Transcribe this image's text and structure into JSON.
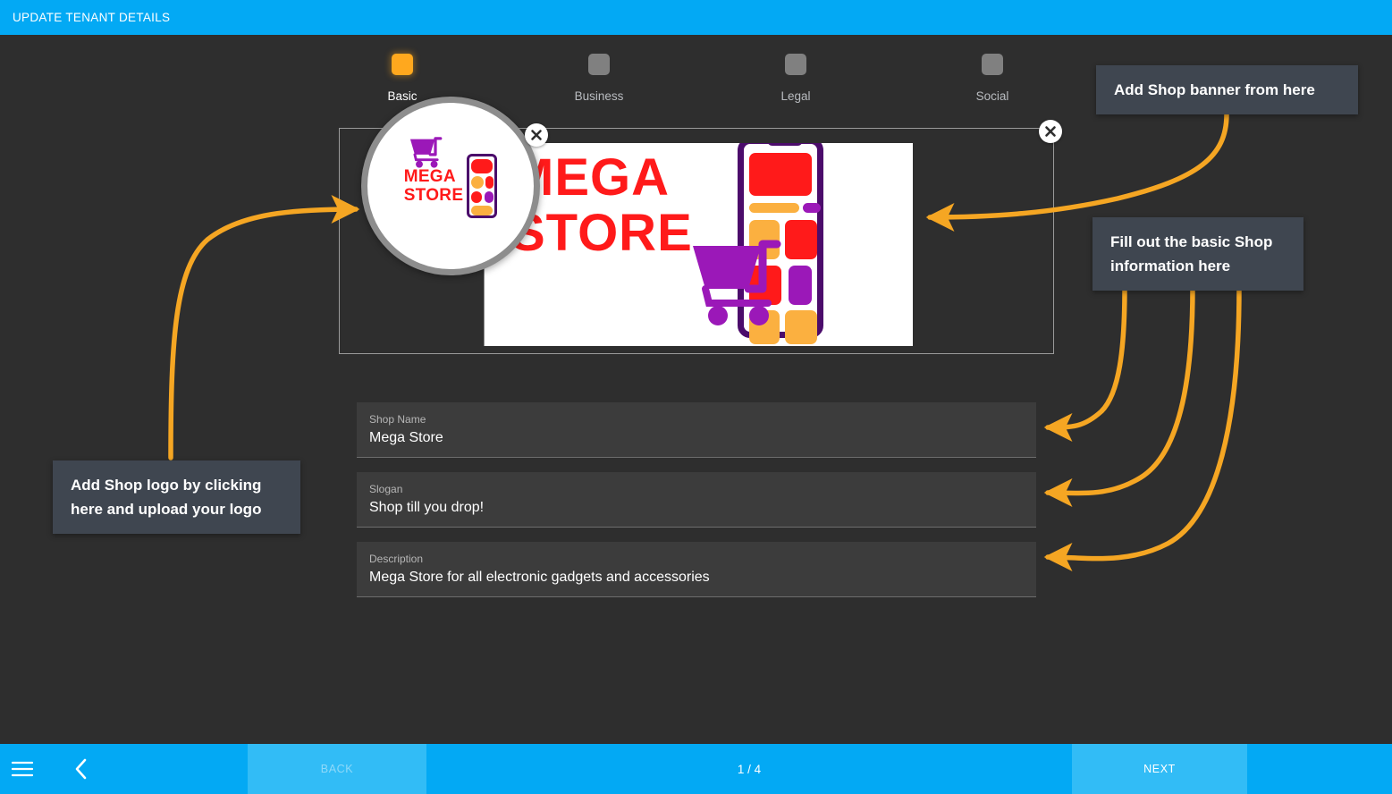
{
  "titlebar": {
    "title": "UPDATE TENANT DETAILS",
    "background": "#03A9F4"
  },
  "steps": {
    "active_index": 0,
    "items": [
      {
        "label": "Basic",
        "state": "active"
      },
      {
        "label": "Business",
        "state": "inactive"
      },
      {
        "label": "Legal",
        "state": "inactive"
      },
      {
        "label": "Social",
        "state": "inactive"
      }
    ],
    "active_color": "#FFA81E",
    "inactive_color": "#808080"
  },
  "media": {
    "logo": {
      "alt": "Mega Store logo",
      "word_line1": "MEGA",
      "word_line2": "STORE",
      "remove_label": "×"
    },
    "banner": {
      "alt": "Mega Store banner",
      "word_line1": "MEGA",
      "word_line2": "STORE",
      "remove_label": "×"
    },
    "colors": {
      "red": "#FF1A1A",
      "purple": "#9B18B8",
      "dark_purple": "#4B0C6B",
      "orange": "#FBB040"
    }
  },
  "form": {
    "fields": [
      {
        "label": "Shop Name",
        "value": "Mega Store",
        "placeholder": "Shop Name"
      },
      {
        "label": "Slogan",
        "value": "Shop till you drop!",
        "placeholder": "Slogan"
      },
      {
        "label": "Description",
        "value": "Mega Store for all electronic gadgets and accessories",
        "placeholder": "Description"
      }
    ]
  },
  "tooltips": {
    "banner": "Add Shop banner from here",
    "info": "Fill out the basic Shop information here",
    "logo": "Add Shop logo by clicking here and upload your logo",
    "background": "#3f4650",
    "arrow_color": "#F5A623"
  },
  "bottombar": {
    "menu_icon": "hamburger-menu-icon",
    "back_icon": "chevron-left-icon",
    "back_label": "BACK",
    "page_indicator": "1 / 4",
    "next_label": "NEXT",
    "background": "#03A9F4",
    "button_background": "#32BCF6"
  }
}
